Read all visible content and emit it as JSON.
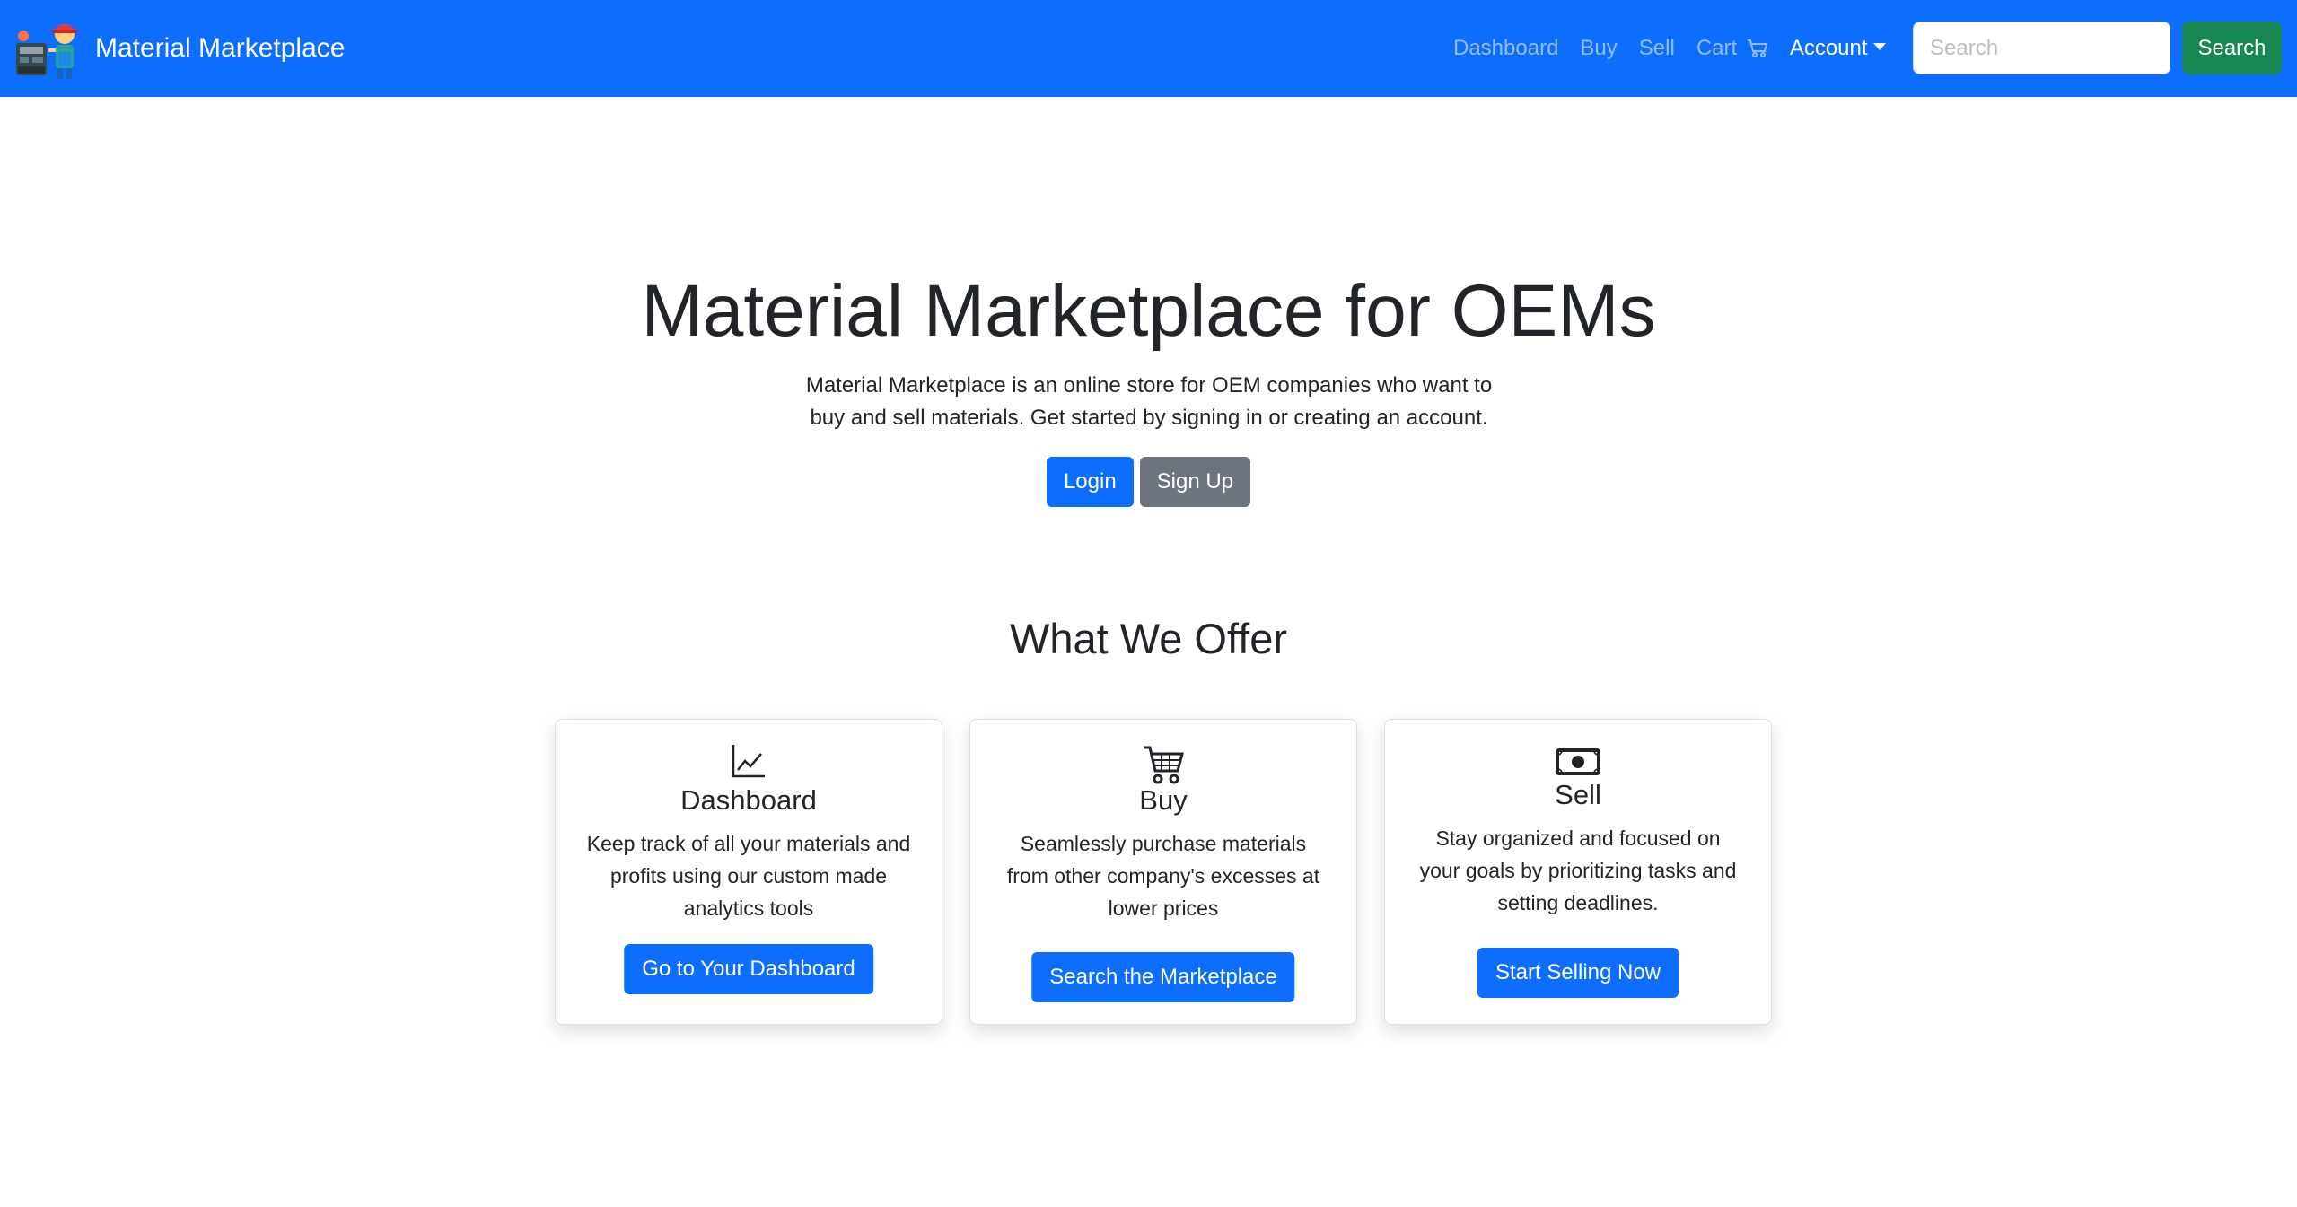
{
  "navbar": {
    "brand": "Material Marketplace",
    "links": {
      "dashboard": "Dashboard",
      "buy": "Buy",
      "sell": "Sell",
      "cart": "Cart",
      "account": "Account"
    },
    "search_placeholder": "Search",
    "search_button": "Search"
  },
  "hero": {
    "title": "Material Marketplace for OEMs",
    "lead_line1": "Material Marketplace is an online store for OEM companies who want to",
    "lead_line2": "buy and sell materials. Get started by signing in or creating an account.",
    "login": "Login",
    "signup": "Sign Up"
  },
  "offer": {
    "title": "What We Offer",
    "cards": [
      {
        "icon": "chart-line-icon",
        "title": "Dashboard",
        "lines": [
          "Keep track of all your materials and",
          "profits using our custom made",
          "analytics tools"
        ],
        "button": "Go to Your Dashboard"
      },
      {
        "icon": "shopping-cart-icon",
        "title": "Buy",
        "lines": [
          "Seamlessly purchase materials",
          "from other company's excesses at",
          "lower prices"
        ],
        "button": "Search the Marketplace"
      },
      {
        "icon": "cash-icon",
        "title": "Sell",
        "lines": [
          "Stay organized and focused on",
          "your goals by prioritizing tasks and",
          "setting deadlines."
        ],
        "button": "Start Selling Now"
      }
    ]
  },
  "colors": {
    "primary": "#0d6efd",
    "secondary": "#6c757d",
    "success": "#198754"
  }
}
